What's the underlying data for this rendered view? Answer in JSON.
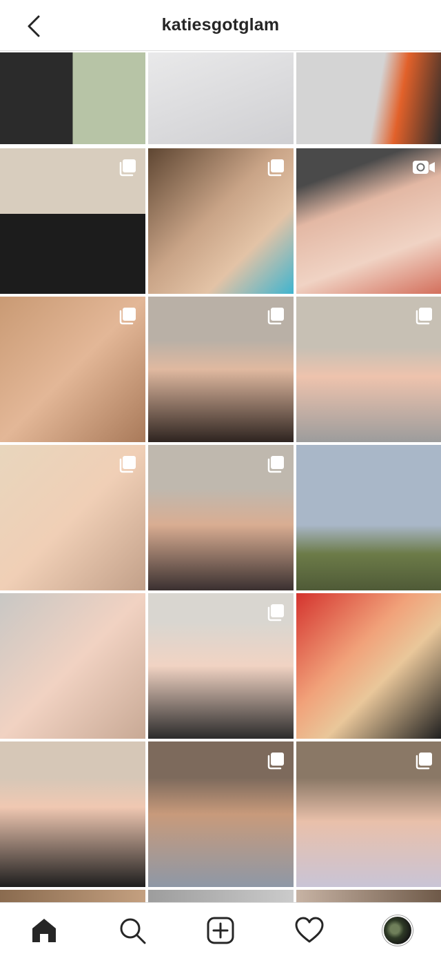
{
  "header": {
    "username": "katiesgotglam",
    "back_icon": "chevron-left-icon"
  },
  "grid": {
    "posts": [
      {
        "type": "image",
        "bg": "linear-gradient(90deg,#2b2b2b 0 50%,#b7c4a6 50% 100%)"
      },
      {
        "type": "image",
        "bg": "linear-gradient(160deg,#e9e9ea,#cfcfd2)"
      },
      {
        "type": "image",
        "bg": "linear-gradient(100deg,#d4d4d4 0 55%,#e2612a 70%,#2b2b2b 100%)"
      },
      {
        "type": "carousel",
        "bg": "linear-gradient(180deg,#d8cdbe 0 45%,#1c1c1c 45% 100%)"
      },
      {
        "type": "carousel",
        "bg": "linear-gradient(135deg,#5e4632,#c9a487 45%,#e3c3a6 70%,#3fb4cf 100%)"
      },
      {
        "type": "video",
        "bg": "linear-gradient(160deg,#4a4a4a 0 20%,#e3b8a4 40%,#f0d3c4 70%,#d36f5c 100%)"
      },
      {
        "type": "carousel",
        "bg": "linear-gradient(135deg,#c99a74,#e3b797 50%,#a97a5a 100%)"
      },
      {
        "type": "carousel",
        "bg": "linear-gradient(180deg,#b9b0a6 0 30%,#e0b9a0 50%,#2e2420 100%)"
      },
      {
        "type": "carousel",
        "bg": "linear-gradient(180deg,#c7c0b4 0 35%,#eec3ad 55%,#9c9c9c 100%)"
      },
      {
        "type": "carousel",
        "bg": "linear-gradient(135deg,#e8d6bd,#f0cfb6 50%,#c2a089 100%)"
      },
      {
        "type": "carousel",
        "bg": "linear-gradient(180deg,#bfb8ae 0 30%,#d9ad92 55%,#3a3030 100%)"
      },
      {
        "type": "image",
        "bg": "linear-gradient(180deg,#a9b7c8 0 55%,#6c7b48 75%,#4f5a37 100%)"
      },
      {
        "type": "image",
        "bg": "linear-gradient(135deg,#c8c7c4,#f1d2c2 50%,#c8a995 100%)"
      },
      {
        "type": "carousel",
        "bg": "linear-gradient(180deg,#d9d6d0 0 20%,#f1d3c3 50%,#2b2b2b 100%)"
      },
      {
        "type": "image",
        "bg": "linear-gradient(135deg,#d4332e,#f1a27a 40%,#e9c79a 60%,#1f1f1f 100%)"
      },
      {
        "type": "image",
        "bg": "linear-gradient(180deg,#d6c7b7 0 25%,#f0c8b2 45%,#1e1e1e 100%)"
      },
      {
        "type": "carousel",
        "bg": "linear-gradient(180deg,#7d6a5c 0 25%,#c89a7b 50%,#8e98a6 100%)"
      },
      {
        "type": "carousel",
        "bg": "linear-gradient(180deg,#8a7866 0 25%,#e9c0aa 55%,#c9c4d6 100%)"
      },
      {
        "type": "image",
        "bg": "linear-gradient(90deg,#8a6b4f,#c4a080)"
      },
      {
        "type": "carousel",
        "bg": "linear-gradient(90deg,#9d9d9d,#cbcbcb)"
      },
      {
        "type": "carousel",
        "bg": "linear-gradient(90deg,#c7b3a4,#6e5948)"
      }
    ]
  },
  "bottom_nav": {
    "items": [
      {
        "name": "home",
        "icon": "home-icon",
        "active": true
      },
      {
        "name": "search",
        "icon": "search-icon",
        "active": false
      },
      {
        "name": "create",
        "icon": "add-post-icon",
        "active": false
      },
      {
        "name": "activity",
        "icon": "heart-icon",
        "active": false
      },
      {
        "name": "profile",
        "icon": "profile-avatar",
        "active": false
      }
    ]
  },
  "colors": {
    "text": "#262626",
    "divider": "#dbdbdb",
    "background": "#ffffff"
  }
}
